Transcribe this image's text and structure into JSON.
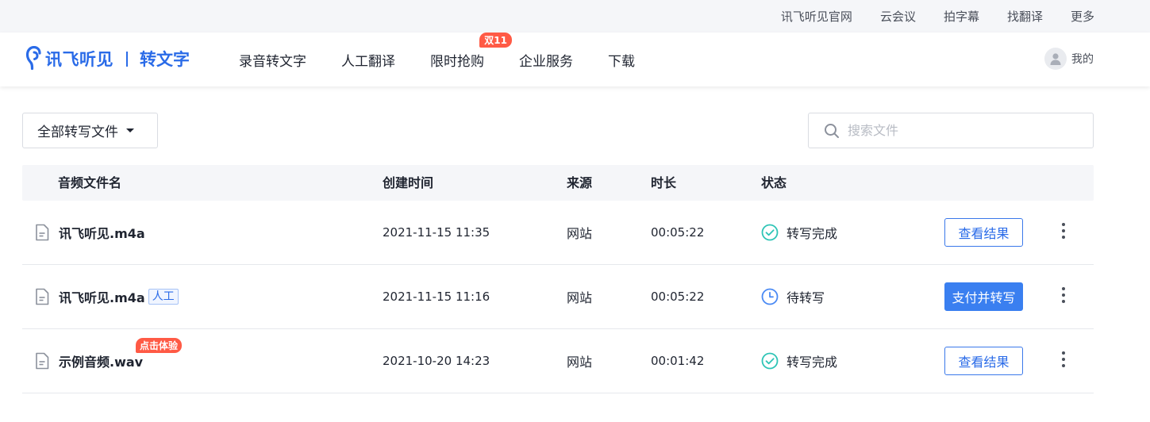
{
  "topbar": {
    "links": [
      "讯飞听见官网",
      "云会议",
      "拍字幕",
      "找翻译",
      "更多"
    ]
  },
  "header": {
    "brand": "讯飞听见",
    "product": "转文字",
    "nav": [
      {
        "label": "录音转文字",
        "badge": ""
      },
      {
        "label": "人工翻译",
        "badge": ""
      },
      {
        "label": "限时抢购",
        "badge": "双11"
      },
      {
        "label": "企业服务",
        "badge": ""
      },
      {
        "label": "下载",
        "badge": ""
      }
    ],
    "user_label": "我的"
  },
  "toolbar": {
    "filter_label": "全部转写文件",
    "search_placeholder": "搜索文件"
  },
  "table": {
    "columns": {
      "name": "音频文件名",
      "created": "创建时间",
      "source": "来源",
      "duration": "时长",
      "status": "状态"
    },
    "rows": [
      {
        "name": "讯飞听见.m4a",
        "tag": "",
        "badge": "",
        "created": "2021-11-15 11:35",
        "source": "网站",
        "duration": "00:05:22",
        "status": "转写完成",
        "status_icon": "check-circle-icon",
        "action": "查看结果"
      },
      {
        "name": "讯飞听见.m4a",
        "tag": "人工",
        "badge": "",
        "created": "2021-11-15 11:16",
        "source": "网站",
        "duration": "00:05:22",
        "status": "待转写",
        "status_icon": "clock-icon",
        "action": "支付并转写"
      },
      {
        "name": "示例音频.wav",
        "tag": "",
        "badge": "点击体验",
        "created": "2021-10-20 14:23",
        "source": "网站",
        "duration": "00:01:42",
        "status": "转写完成",
        "status_icon": "check-circle-icon",
        "action": "查看结果"
      }
    ]
  },
  "colors": {
    "brand_blue": "#2a6be8",
    "button_blue": "#3a7ff0",
    "badge_red": "#ff5a45",
    "success_teal": "#2ec4b6",
    "pending_blue": "#4a8af4"
  }
}
